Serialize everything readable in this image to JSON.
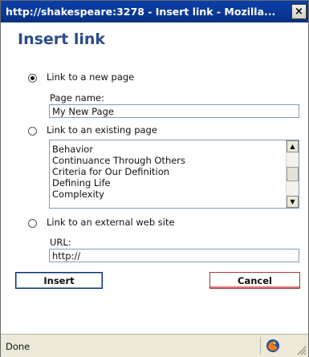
{
  "window": {
    "title": "http://shakespeare:3278 - Insert link - Mozilla...",
    "close_label": "×"
  },
  "dialog": {
    "heading": "Insert link",
    "option_new": {
      "label": "Link to a new page",
      "selected": true,
      "field_label": "Page name:",
      "field_value": "My New Page"
    },
    "option_existing": {
      "label": "Link to an existing page",
      "selected": false,
      "pages": [
        "Behavior",
        "Continuance Through Others",
        "Criteria for Our Definition",
        "Defining Life",
        "Complexity"
      ]
    },
    "option_external": {
      "label": "Link to an external web site",
      "selected": false,
      "field_label": "URL:",
      "field_value": "http://"
    },
    "insert_label": "Insert",
    "cancel_label": "Cancel"
  },
  "statusbar": {
    "text": "Done"
  },
  "icons": {
    "browser": "firefox-icon",
    "close": "close-icon"
  }
}
